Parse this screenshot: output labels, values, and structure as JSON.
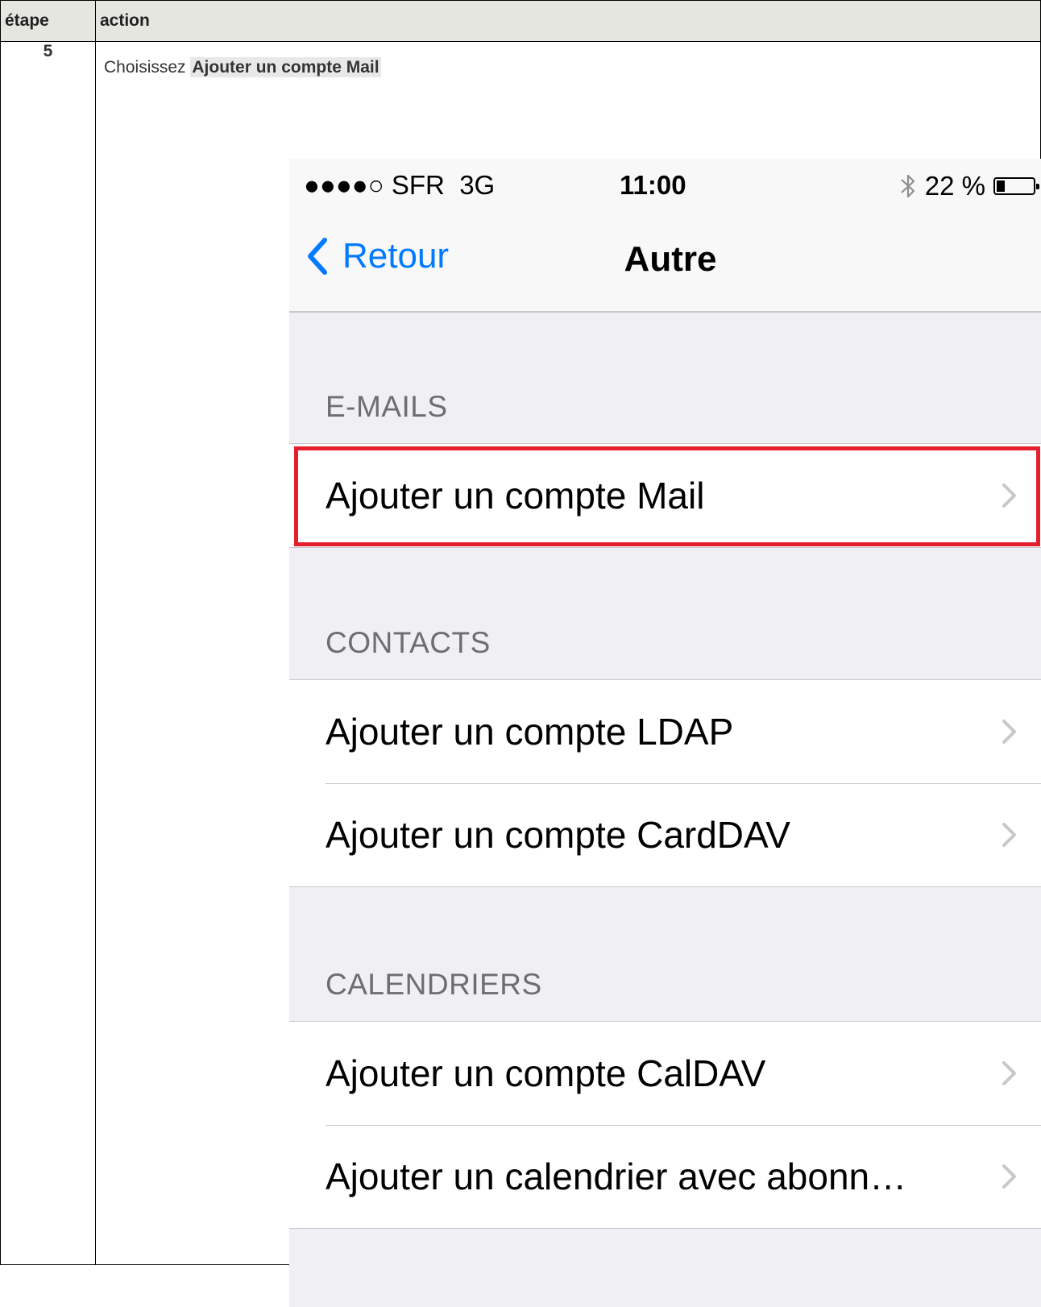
{
  "table": {
    "header_step": "étape",
    "header_action": "action",
    "step_number": "5",
    "instruction_prefix": "Choisissez ",
    "instruction_target": "Ajouter un compte Mail"
  },
  "phone": {
    "status_bar": {
      "carrier": "●●●●○ SFR",
      "network": "3G",
      "time": "11:00",
      "battery_text": "22 %",
      "battery_level": 0.22
    },
    "nav": {
      "back_label": "Retour",
      "title": "Autre"
    },
    "sections": [
      {
        "header": "E-MAILS",
        "rows": [
          "Ajouter un compte Mail"
        ]
      },
      {
        "header": "CONTACTS",
        "rows": [
          "Ajouter un compte LDAP",
          "Ajouter un compte CardDAV"
        ]
      },
      {
        "header": "CALENDRIERS",
        "rows": [
          "Ajouter un compte CalDAV",
          "Ajouter un calendrier avec abonn…"
        ]
      }
    ],
    "highlight_color": "#e4202f",
    "accent_color": "#007aff"
  }
}
